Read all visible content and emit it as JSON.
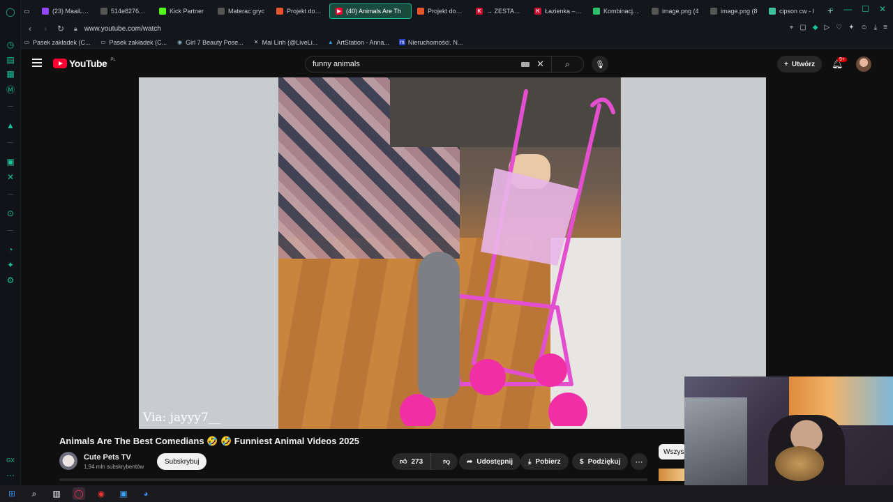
{
  "browser": {
    "tabs": [
      {
        "label": "(23) MaaiLinh",
        "color": "#9146ff"
      },
      {
        "label": "514e827665c",
        "color": "#555"
      },
      {
        "label": "Kick Partner",
        "color": "#53fc18"
      },
      {
        "label": "Materac gryc",
        "color": "#555"
      },
      {
        "label": "Projekt domu",
        "color": "#e4572e"
      },
      {
        "label": "(40) Animals Are Th",
        "color": "#ff0033",
        "active": true
      },
      {
        "label": "Projekt domu",
        "color": "#e4572e"
      },
      {
        "label": "→ ZESTAW M",
        "color": "#d10b2f"
      },
      {
        "label": "Łazienka – in",
        "color": "#d10b2f"
      },
      {
        "label": "Kombinacje n",
        "color": "#2dbf6b"
      },
      {
        "label": "image.png (4",
        "color": "#555"
      },
      {
        "label": "image.png (8",
        "color": "#555"
      },
      {
        "label": "cipson cw - I",
        "color": "#3fbf9a"
      }
    ],
    "url": "www.youtube.com/watch",
    "bookmarks": [
      "Pasek zakładek (C...",
      "Pasek zakładek (C...",
      "Girl 7 Beauty Pose...",
      "Mai Linh (@LiveLi...",
      "ArtStation - Anna...",
      "Nieruchomości. N..."
    ]
  },
  "youtube": {
    "region": "PL",
    "logo_text": "YouTube",
    "search_query": "funny animals",
    "create_label": "Utwórz",
    "notif_badge": "9+",
    "video_watermark": "Via: jayyy7__",
    "title": "Animals Are The Best Comedians 🤣 🤣 Funniest Animal Videos 2025",
    "channel": {
      "name": "Cute Pets TV",
      "subscribers": "1,94 mln subskrybentów"
    },
    "subscribe_label": "Subskrybuj",
    "likes": "273",
    "share_label": "Udostępnij",
    "download_label": "Pobierz",
    "thanks_label": "Podziękuj",
    "chip_label": "Wszys"
  },
  "colors": {
    "accent": "#19c39a",
    "youtube_red": "#ff0033",
    "bg": "#0f0f0f"
  }
}
